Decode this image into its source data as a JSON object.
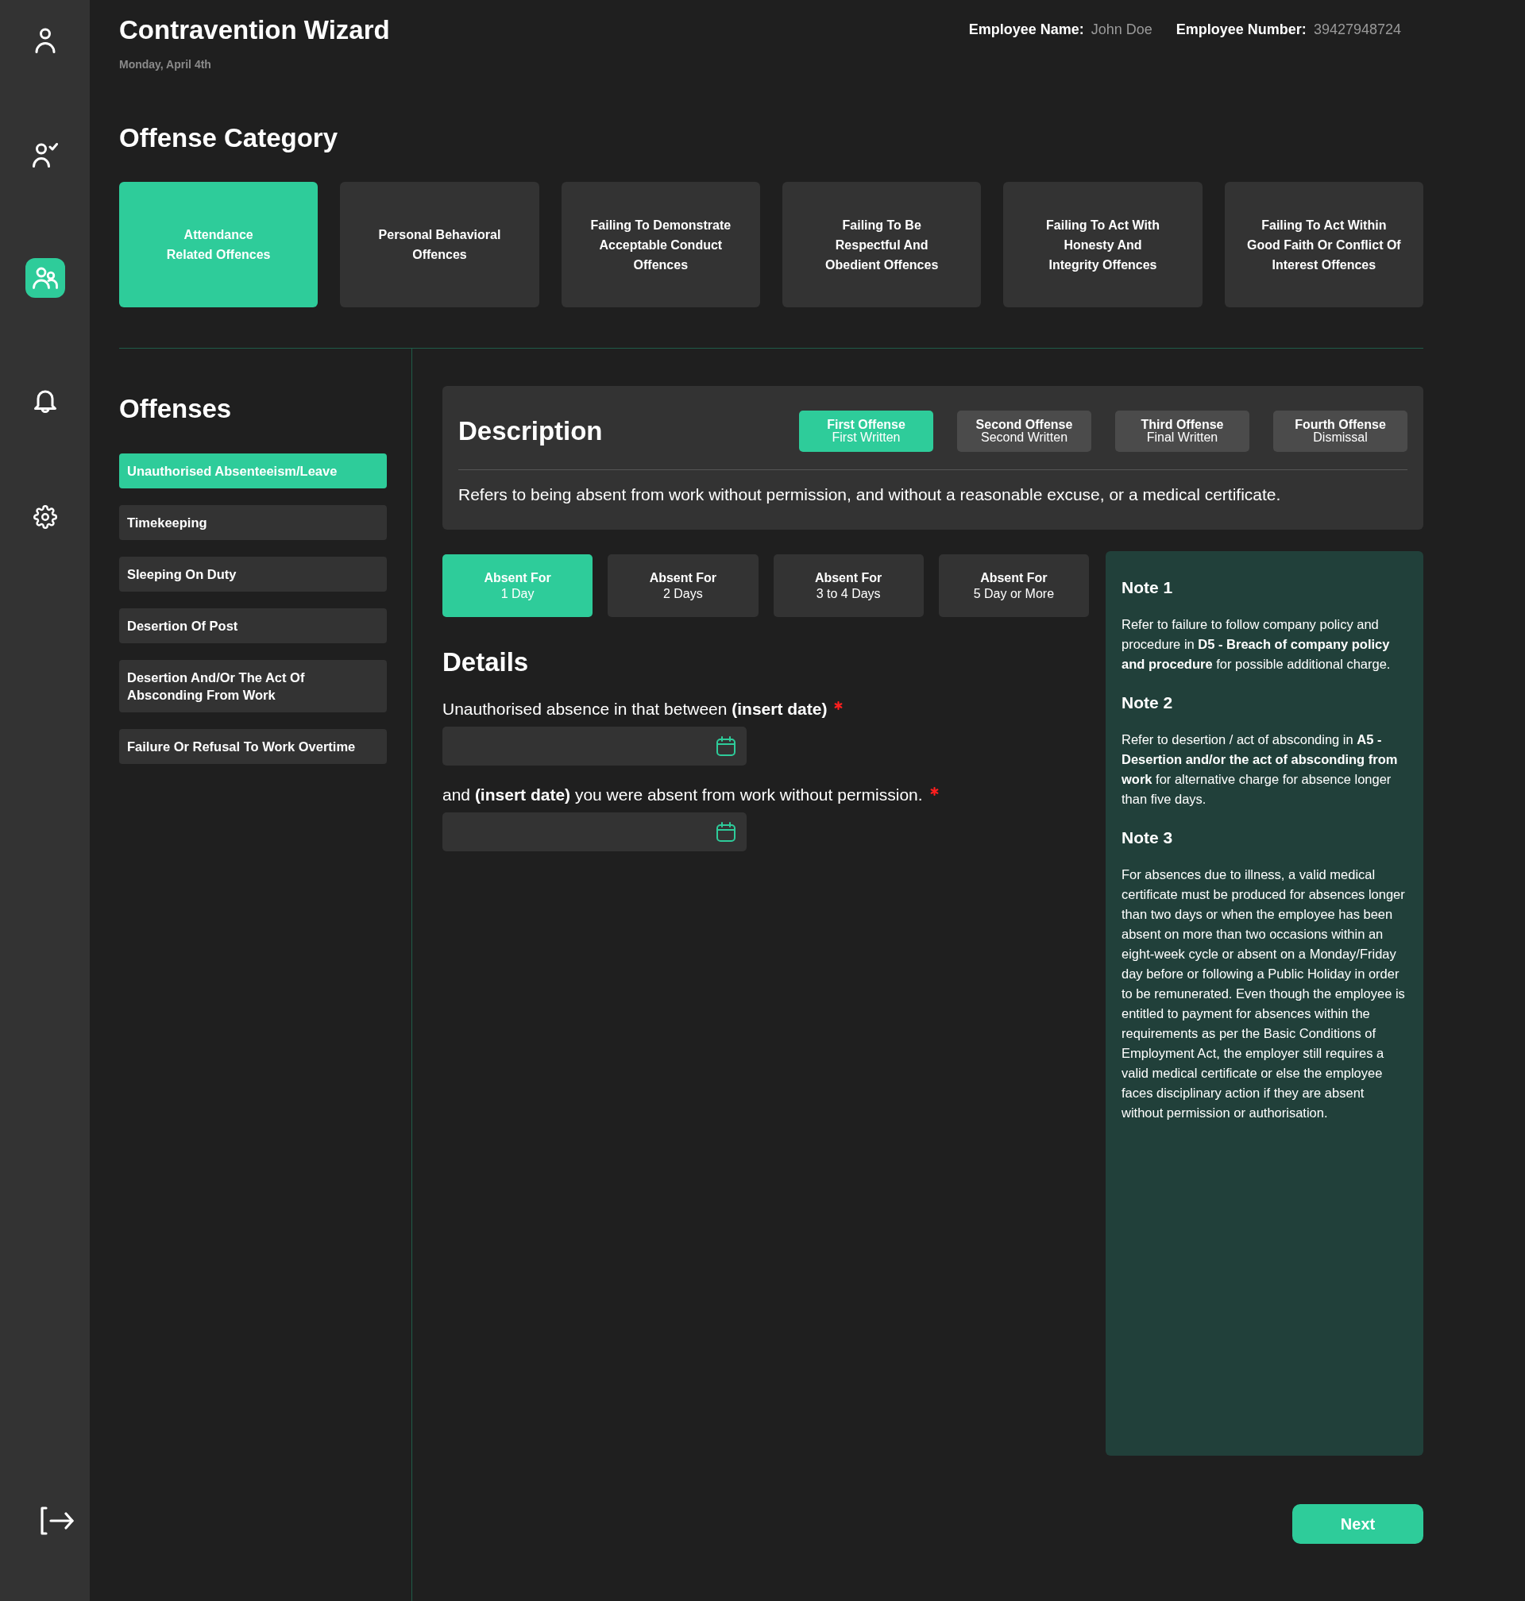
{
  "sidebar": {
    "items": [
      {
        "selected": false
      },
      {
        "selected": false
      },
      {
        "selected": true
      },
      {
        "selected": false
      },
      {
        "selected": false
      }
    ]
  },
  "header": {
    "title": "Contravention Wizard",
    "date": "Monday, April 4th",
    "employee_fields": [
      {
        "label": "Employee Name:",
        "value": "John Doe"
      },
      {
        "label": "Employee Number:",
        "value": "39427948724"
      }
    ]
  },
  "offense_category": {
    "heading": "Offense Category",
    "categories": [
      {
        "label": "Attendance\nRelated Offences",
        "selected": true
      },
      {
        "label": "Personal Behavioral\nOffences",
        "selected": false
      },
      {
        "label": "Failing To Demonstrate\nAcceptable Conduct\nOffences",
        "selected": false
      },
      {
        "label": "Failing To Be\nRespectful And\nObedient Offences",
        "selected": false
      },
      {
        "label": "Failing To Act With\nHonesty And\nIntegrity Offences",
        "selected": false
      },
      {
        "label": "Failing To Act Within\nGood Faith Or Conflict Of\nInterest Offences",
        "selected": false
      }
    ]
  },
  "offenses": {
    "heading": "Offenses",
    "items": [
      {
        "label": "Unauthorised Absenteeism/Leave",
        "selected": true
      },
      {
        "label": "Timekeeping",
        "selected": false
      },
      {
        "label": "Sleeping On Duty",
        "selected": false
      },
      {
        "label": "Desertion Of Post",
        "selected": false
      },
      {
        "label": "Desertion And/Or The Act Of Absconding From Work",
        "selected": false
      },
      {
        "label": "Failure Or Refusal To Work Overtime",
        "selected": false
      }
    ]
  },
  "description": {
    "heading": "Description",
    "levels": [
      {
        "title": "First Offense",
        "subtitle": "First Written",
        "selected": true
      },
      {
        "title": "Second Offense",
        "subtitle": "Second Written",
        "selected": false
      },
      {
        "title": "Third Offense",
        "subtitle": "Final Written",
        "selected": false
      },
      {
        "title": "Fourth Offense",
        "subtitle": "Dismissal",
        "selected": false
      }
    ],
    "text": "Refers to being absent from work without permission, and without a reasonable excuse, or a medical certificate."
  },
  "durations": [
    {
      "title": "Absent For",
      "subtitle": "1 Day",
      "selected": true
    },
    {
      "title": "Absent For",
      "subtitle": "2 Days",
      "selected": false
    },
    {
      "title": "Absent For",
      "subtitle": "3 to 4 Days",
      "selected": false
    },
    {
      "title": "Absent For",
      "subtitle": "5 Day or More",
      "selected": false
    }
  ],
  "details": {
    "heading": "Details",
    "fields": [
      {
        "label": "Unauthorised absence in that between **(insert date)**",
        "required": true
      },
      {
        "label": "and **(insert date)** you were absent from work without permission.",
        "required": true
      }
    ]
  },
  "notes": [
    {
      "title": "Note 1",
      "text": "Refer to failure to follow company policy and procedure in **D5 - Breach of company policy and procedure** for possible additional charge."
    },
    {
      "title": "Note 2",
      "text": "Refer to desertion / act of absconding in **A5 - Desertion and/or the act of absconding from work** for alternative charge for absence longer than five days."
    },
    {
      "title": "Note 3",
      "text": "For absences due to illness, a valid medical certificate must be produced for absences longer than two days or when the employee has been absent on more than two occasions within an eight-week cycle or absent on a Monday/Friday day before or following a Public Holiday in order to be remunerated. Even though the employee is entitled to payment for absences within the requirements as per the Basic Conditions of Employment Act, the employer still requires a valid medical certificate or else the employee faces disciplinary action if they are absent without permission or authorisation."
    }
  ],
  "next_button": {
    "label": "Next"
  }
}
